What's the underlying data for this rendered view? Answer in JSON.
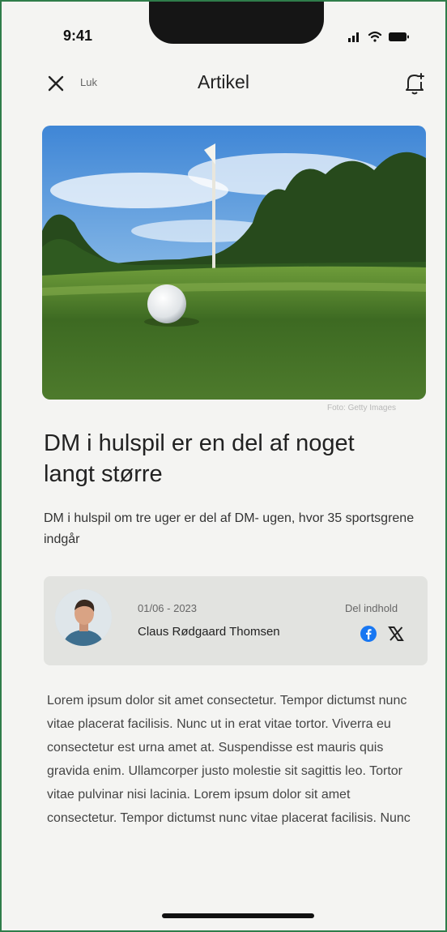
{
  "status": {
    "time": "9:41"
  },
  "header": {
    "close_label": "Luk",
    "title": "Artikel"
  },
  "hero": {
    "photo_credit": "Foto: Getty Images"
  },
  "article": {
    "headline": "DM i hulspil er en del af noget langt større",
    "subtitle": "DM i hulspil om tre uger er del af DM- ugen, hvor 35 sportsgrene indgår",
    "body": "Lorem ipsum dolor sit amet consectetur. Tempor dictumst nunc vitae placerat facilisis. Nunc ut in erat vitae tortor. Viverra eu consectetur est urna amet at. Suspendisse est mauris quis gravida enim. Ullamcorper justo molestie sit sagittis leo. Tortor vitae pulvinar nisi lacinia.  Lorem ipsum dolor sit amet consectetur. Tempor dictumst nunc vitae placerat facilisis. Nunc"
  },
  "author_card": {
    "date": "01/06 - 2023",
    "author": "Claus Rødgaard Thomsen",
    "share_label": "Del indhold"
  },
  "colors": {
    "frame_border": "#2f7d4a",
    "facebook": "#1877f2",
    "card_bg": "#e2e3e0"
  },
  "icons": [
    "close-icon",
    "bell-icon",
    "facebook-icon",
    "x-logo-icon",
    "signal-icon",
    "wifi-icon",
    "battery-icon"
  ]
}
